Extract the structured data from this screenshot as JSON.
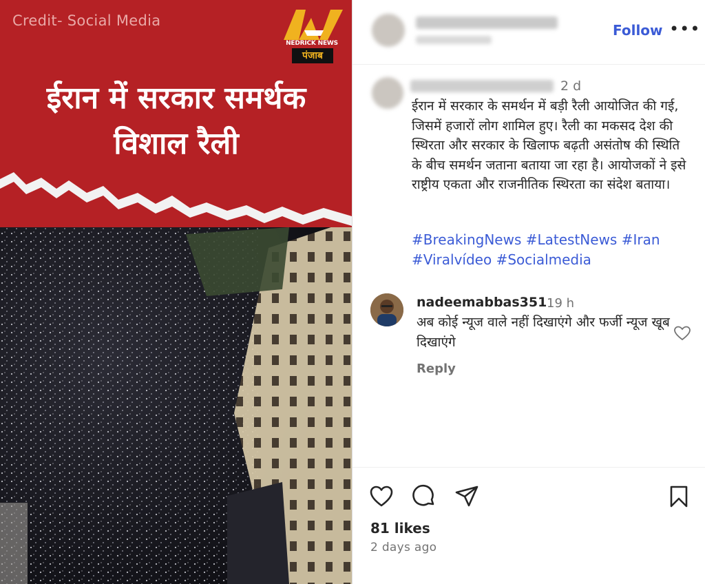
{
  "media": {
    "credit": "Credit- Social Media",
    "logo_name": "NEDRICK NEWS",
    "logo_region": "पंजाब",
    "headline_line1": "ईरान में सरकार समर्थक",
    "headline_line2": "विशाल रैली"
  },
  "header": {
    "follow_label": "Follow",
    "more_label": "•••"
  },
  "caption": {
    "time": "2 d",
    "text": "ईरान में सरकार के समर्थन में बड़ी रैली आयोजित की गई, जिसमें हजारों लोग शामिल हुए। रैली का मकसद देश की स्थिरता और सरकार के खिलाफ बढ़ती असंतोष की स्थिति के बीच समर्थन जताना बताया जा रहा है। आयोजकों ने इसे राष्ट्रीय एकता और राजनीतिक स्थिरता का संदेश बताया।",
    "hashtags": [
      "#BreakingNews",
      "#LatestNews",
      "#Iran",
      "#Viralvídeo",
      "#Socialmedia"
    ]
  },
  "comment": {
    "username": "nadeemabbas351",
    "time": "19 h",
    "text": "अब कोई न्यूज वाले नहीं दिखाएंगे और फर्जी न्यूज खूब दिखाएंगे",
    "reply_label": "Reply"
  },
  "footer": {
    "likes": "81 likes",
    "date": "2 days ago"
  },
  "colors": {
    "banner_red": "#b52125",
    "link_blue": "#3b5bd6",
    "logo_gold": "#f0b21f"
  },
  "icons": [
    "heart-icon",
    "comment-icon",
    "share-icon",
    "bookmark-icon",
    "more-icon",
    "like-comment-icon"
  ]
}
